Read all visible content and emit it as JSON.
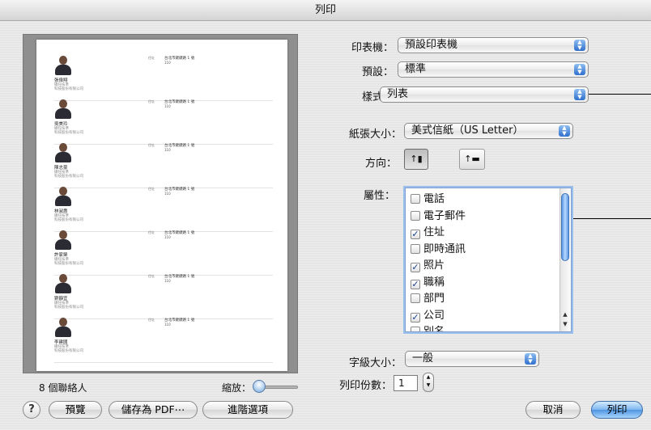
{
  "window": {
    "title": "列印"
  },
  "preview": {
    "contacts": [
      {
        "name": "張偉翔",
        "title": "總任技準",
        "company": "科技股份有限公司",
        "label": "住址",
        "address": "台北市鍵鍵路 1 號",
        "zip": "110"
      },
      {
        "name": "吳美玲",
        "title": "總任技準",
        "company": "科技股份有限公司",
        "label": "住址",
        "address": "台北市鍵鍵路 1 號",
        "zip": "110"
      },
      {
        "name": "陳志豪",
        "title": "總任技準",
        "company": "科技股份有限公司",
        "label": "住址",
        "address": "台北市鍵鍵路 1 號",
        "zip": "110"
      },
      {
        "name": "林淑惠",
        "title": "總任技準",
        "company": "科技股份有限公司",
        "label": "住址",
        "address": "台北市鍵鍵路 1 號",
        "zip": "110"
      },
      {
        "name": "許家榮",
        "title": "總任技準",
        "company": "科技股份有限公司",
        "label": "住址",
        "address": "台北市鍵鍵路 1 號",
        "zip": "110"
      },
      {
        "name": "劉靜宜",
        "title": "總任技準",
        "company": "科技股份有限公司",
        "label": "住址",
        "address": "台北市鍵鍵路 1 號",
        "zip": "110"
      },
      {
        "name": "李建國",
        "title": "總任技準",
        "company": "科技股份有限公司",
        "label": "住址",
        "address": "台北市鍵鍵路 1 號",
        "zip": "110"
      }
    ]
  },
  "footer_left": {
    "count_label": "8 個聯絡人",
    "zoom_label": "縮放：",
    "zoom_level": 0.1
  },
  "form": {
    "printer_label": "印表機：",
    "printer_value": "預設印表機",
    "presets_label": "預設：",
    "presets_value": "標準",
    "style_label": "樣式：",
    "style_value": "列表",
    "paper_label": "紙張大小：",
    "paper_value": "美式信紙（US Letter）",
    "orientation_label": "方向：",
    "orientation_selected": "portrait",
    "attributes_label": "屬性：",
    "attributes": [
      {
        "label": "電話",
        "checked": false
      },
      {
        "label": "電子郵件",
        "checked": false
      },
      {
        "label": "住址",
        "checked": true
      },
      {
        "label": "即時通訊",
        "checked": false
      },
      {
        "label": "照片",
        "checked": true
      },
      {
        "label": "職稱",
        "checked": true
      },
      {
        "label": "部門",
        "checked": false
      },
      {
        "label": "公司",
        "checked": true
      },
      {
        "label": "別名",
        "checked": false
      }
    ],
    "font_size_label": "字級大小：",
    "font_size_value": "一般",
    "copies_label": "列印份數：",
    "copies_value": "1"
  },
  "buttons": {
    "help": "?",
    "preview": "預覽",
    "save_pdf": "儲存為 PDF⋯",
    "advanced": "進階選項",
    "cancel": "取消",
    "print": "列印"
  },
  "colors": {
    "accent": "#4f95e0"
  }
}
